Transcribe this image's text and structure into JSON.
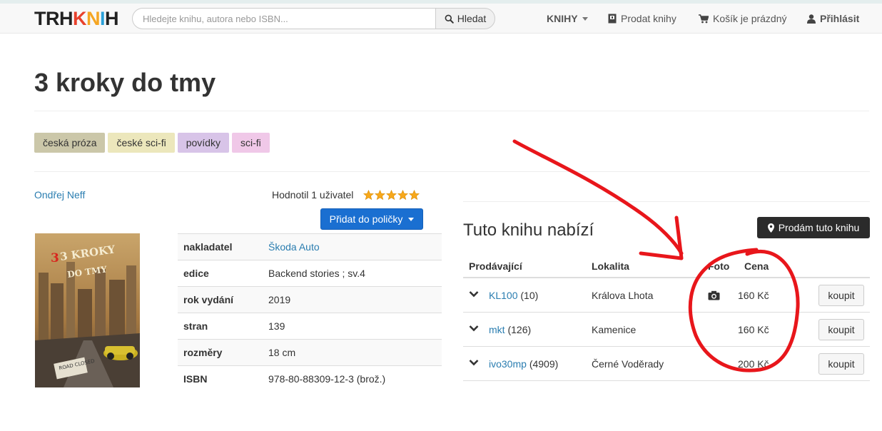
{
  "nav": {
    "logo": {
      "p1": "TRH",
      "p2": "K",
      "p3": "N",
      "p4": "I",
      "p5": "H"
    },
    "search_placeholder": "Hledejte knihu, autora nebo ISBN...",
    "search_button": "Hledat",
    "books_menu": "KNIHY",
    "sell_books": "Prodat knihy",
    "cart": "Košík je prázdný",
    "login": "Přihlásit"
  },
  "book": {
    "title": "3 kroky do tmy",
    "author": "Ondřej Neff",
    "rating_text": "Hodnotil 1 uživatel",
    "rating_stars": 5,
    "shelf_button": "Přidat do poličky",
    "cover": {
      "line1": "3 KROKY",
      "line2": "DO TMY",
      "sign": "ROAD CLOSED"
    }
  },
  "tags": [
    {
      "label": "česká próza",
      "color": "#cbc7a9"
    },
    {
      "label": "české sci-fi",
      "color": "#ece7bc"
    },
    {
      "label": "povídky",
      "color": "#d8c4e8"
    },
    {
      "label": "sci-fi",
      "color": "#f0c8e8"
    }
  ],
  "details": [
    {
      "key": "nakladatel",
      "value": "Škoda Auto",
      "link": true
    },
    {
      "key": "edice",
      "value": "Backend stories ; sv.4",
      "link": false
    },
    {
      "key": "rok vydání",
      "value": "2019",
      "link": false
    },
    {
      "key": "stran",
      "value": "139",
      "link": false
    },
    {
      "key": "rozměry",
      "value": "18 cm",
      "link": false
    },
    {
      "key": "ISBN",
      "value": "978-80-88309-12-3 (brož.)",
      "link": false
    }
  ],
  "offers": {
    "title": "Tuto knihu nabízí",
    "sell_button": "Prodám tuto knihu",
    "headers": {
      "seller": "Prodávající",
      "location": "Lokalita",
      "photo": "Foto",
      "price": "Cena"
    },
    "rows": [
      {
        "seller": "KL100",
        "count": "(10)",
        "location": "Králova Lhota",
        "has_photo": true,
        "price": "160 Kč",
        "buy": "koupit"
      },
      {
        "seller": "mkt",
        "count": "(126)",
        "location": "Kamenice",
        "has_photo": false,
        "price": "160 Kč",
        "buy": "koupit"
      },
      {
        "seller": "ivo30mp",
        "count": "(4909)",
        "location": "Černé Voděrady",
        "has_photo": false,
        "price": "200 Kč",
        "buy": "koupit"
      }
    ]
  },
  "colors": {
    "accent": "#2a7db0",
    "primary_button": "#1a6fd1",
    "annotation": "#e8161b"
  }
}
